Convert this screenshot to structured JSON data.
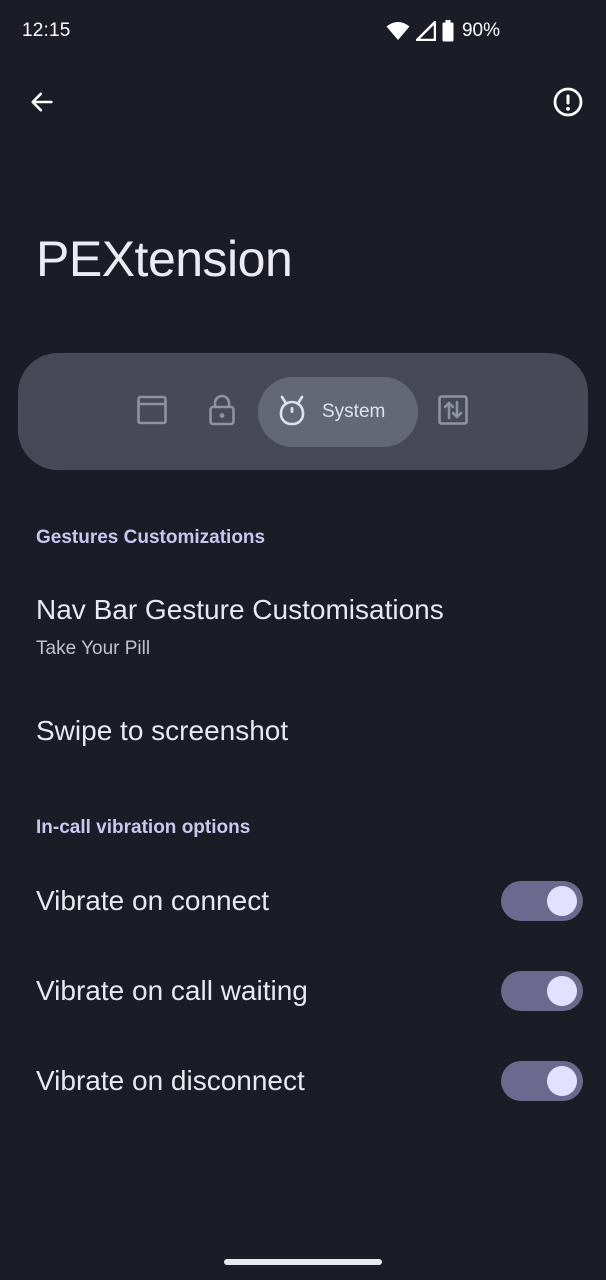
{
  "status": {
    "time": "12:15",
    "battery": "90%",
    "icons": [
      "wifi-icon",
      "cellular-icon",
      "battery-icon"
    ]
  },
  "top_bar": {
    "back_icon": "arrow-back-icon",
    "info_icon": "info-icon"
  },
  "title": "PEXtension",
  "tabs": [
    {
      "icon": "window-icon",
      "label": "",
      "active": false
    },
    {
      "icon": "lock-icon",
      "label": "",
      "active": false
    },
    {
      "icon": "android-head-icon",
      "label": "System",
      "active": true
    },
    {
      "icon": "swap-vertical-icon",
      "label": "",
      "active": false
    }
  ],
  "sections": [
    {
      "header": "Gestures Customizations",
      "items": [
        {
          "title": "Nav Bar Gesture Customisations",
          "summary": "Take Your Pill"
        },
        {
          "title": "Swipe to screenshot"
        }
      ]
    },
    {
      "header": "In-call vibration options",
      "items": [
        {
          "title": "Vibrate on connect",
          "switch": true
        },
        {
          "title": "Vibrate on call waiting",
          "switch": true
        },
        {
          "title": "Vibrate on disconnect",
          "switch": true
        }
      ]
    }
  ],
  "colors": {
    "background": "#1b1c25",
    "accent": "#c7c8f2",
    "switch_track": "#6b6a8e",
    "switch_thumb": "#e2e1ff"
  }
}
